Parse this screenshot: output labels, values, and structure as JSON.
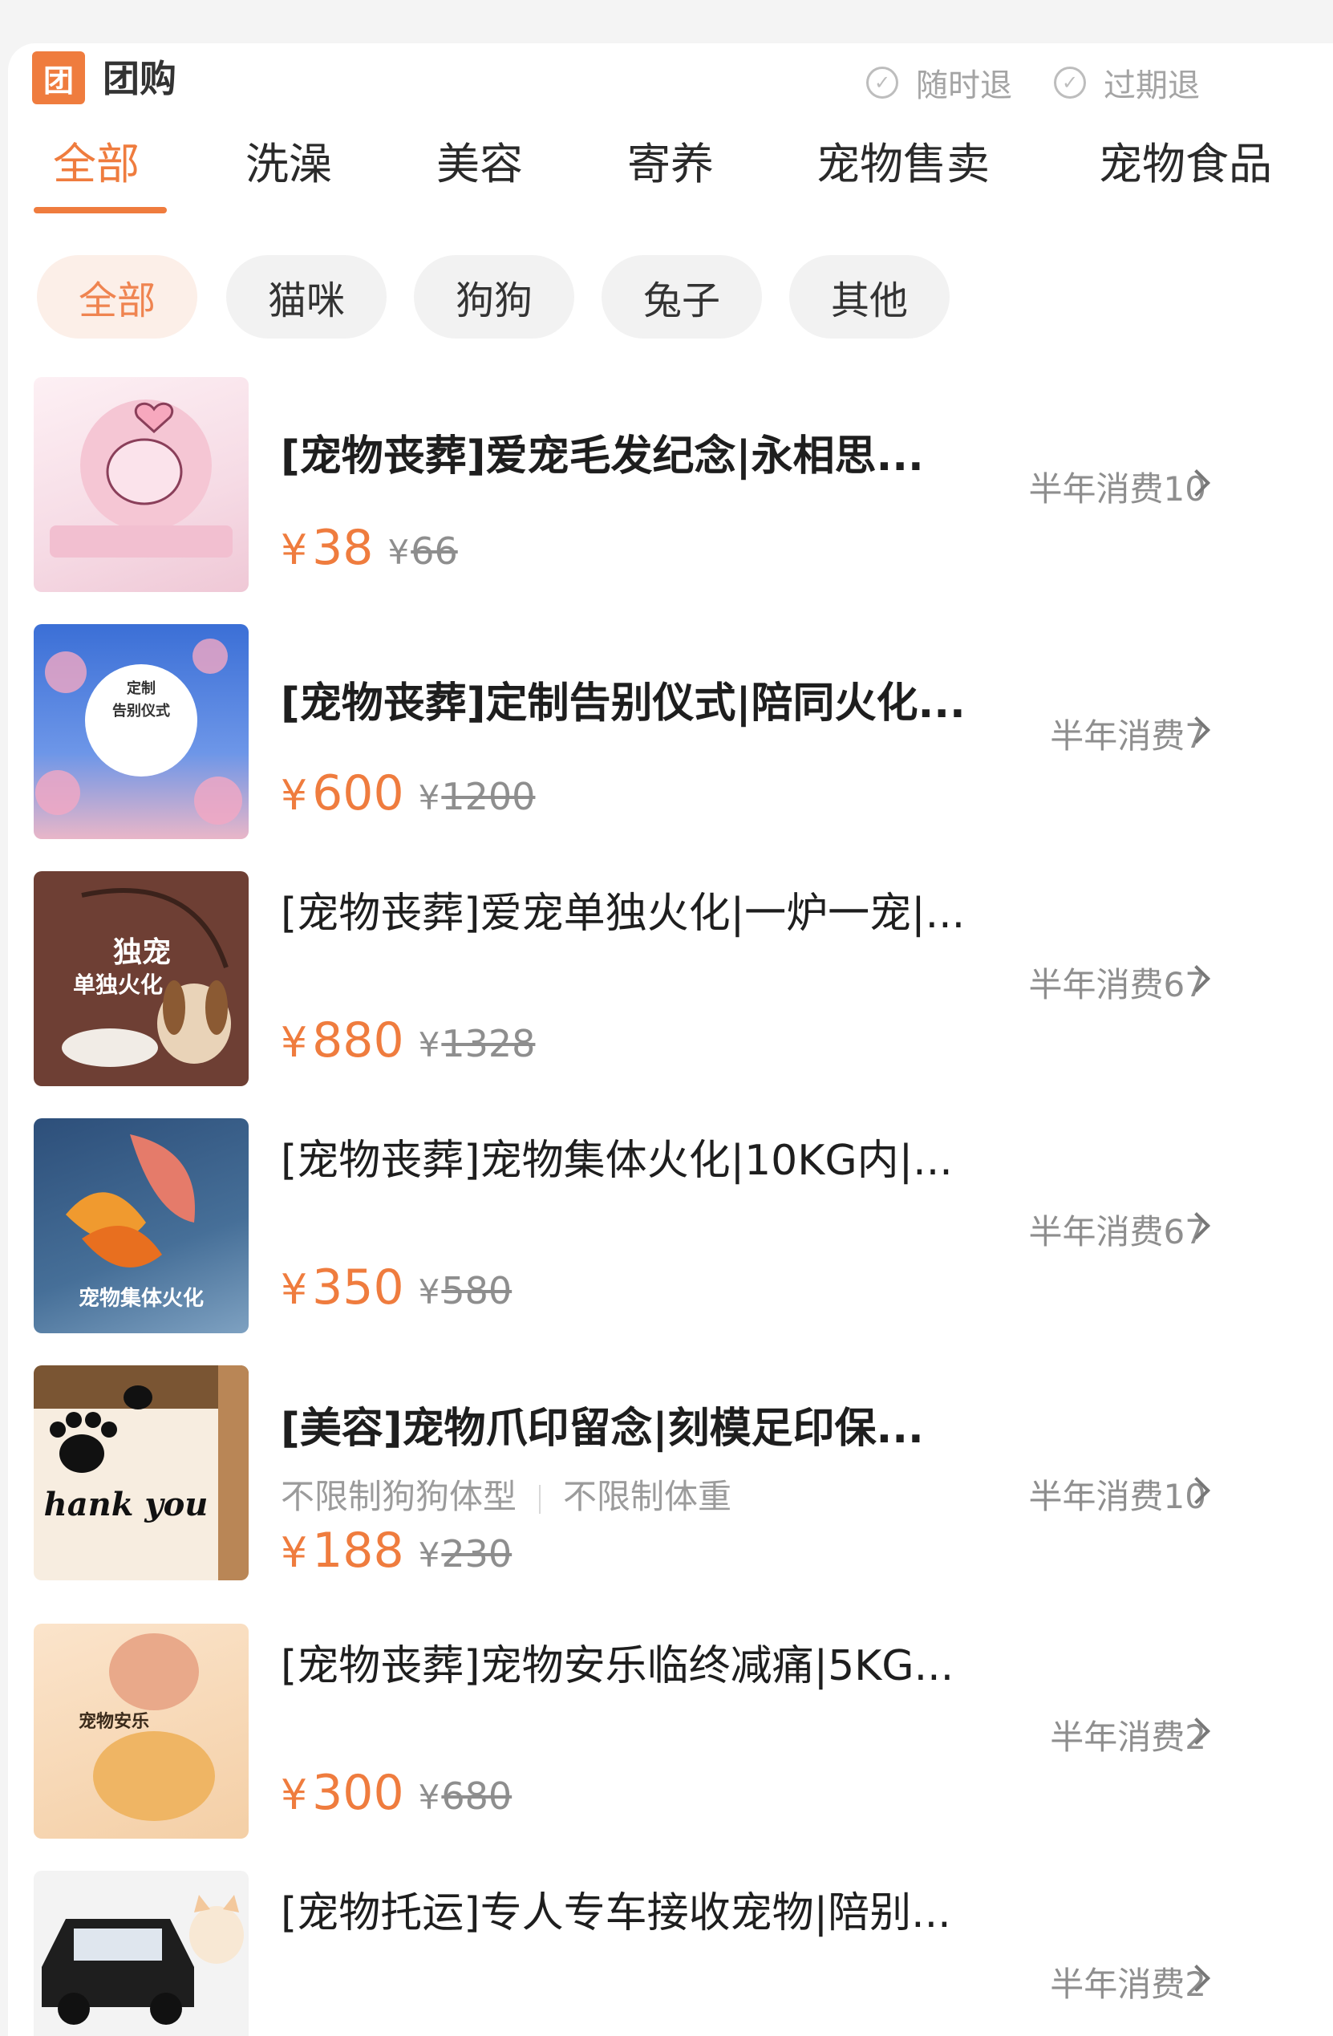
{
  "header": {
    "logo_char": "团",
    "title": "团购",
    "guarantees": [
      "随时退",
      "过期退"
    ]
  },
  "tabs": [
    "全部",
    "洗澡",
    "美容",
    "寄养",
    "宠物售卖",
    "宠物食品"
  ],
  "pet_filters": [
    "全部",
    "猫咪",
    "狗狗",
    "兔子",
    "其他"
  ],
  "thumb_text": {
    "item2": [
      "定制",
      "告别仪式"
    ],
    "item3": [
      "独宠",
      "单独火化"
    ],
    "item4": "宠物集体火化",
    "item5": "hank you",
    "item6": "宠物安乐"
  },
  "items": [
    {
      "title": "[宠物丧葬]爱宠毛发纪念|永相思...",
      "sales": "半年消费10",
      "price": "38",
      "original_price": "66",
      "tags": []
    },
    {
      "title": "[宠物丧葬]定制告别仪式|陪同火化...",
      "sales": "半年消费7",
      "price": "600",
      "original_price": "1200",
      "tags": []
    },
    {
      "title": "[宠物丧葬]爱宠单独火化|一炉一宠|...",
      "sales": "半年消费67",
      "price": "880",
      "original_price": "1328",
      "tags": []
    },
    {
      "title": "[宠物丧葬]宠物集体火化|10KG内|...",
      "sales": "半年消费67",
      "price": "350",
      "original_price": "580",
      "tags": []
    },
    {
      "title": "[美容]宠物爪印留念|刻模足印保...",
      "sales": "半年消费10",
      "price": "188",
      "original_price": "230",
      "tags": [
        "不限制狗狗体型",
        "不限制体重"
      ]
    },
    {
      "title": "[宠物丧葬]宠物安乐临终减痛|5KG...",
      "sales": "半年消费2",
      "price": "300",
      "original_price": "680",
      "tags": []
    },
    {
      "title": "[宠物托运]专人专车接收宠物|陪别...",
      "sales": "半年消费2",
      "price": "",
      "original_price": "",
      "tags": []
    }
  ],
  "currency": "¥",
  "colors": {
    "accent": "#ef7c3e",
    "chip_active_bg": "#fcefe8",
    "muted": "#8e8e8e"
  }
}
